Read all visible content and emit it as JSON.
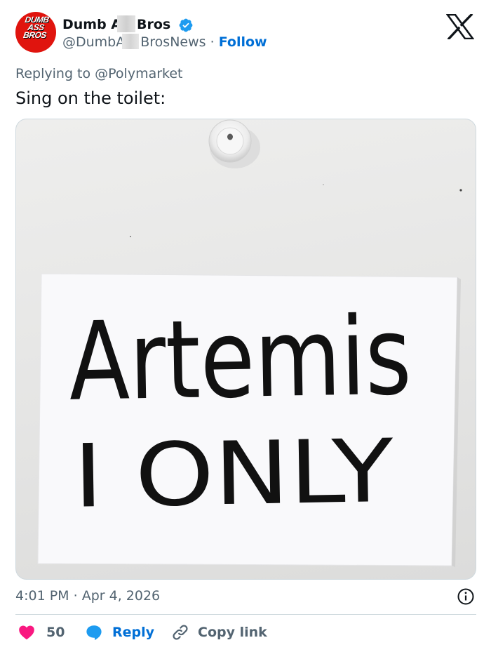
{
  "header": {
    "avatar_text": [
      "DUMB",
      "ASS",
      "BROS"
    ],
    "display_name_start": "Dumb A",
    "display_name_end": "Bros",
    "handle_start": "@DumbA",
    "handle_end": "BrosNews",
    "separator": "·",
    "follow_label": "Follow",
    "verified": true,
    "verified_color": "#1d9bf0"
  },
  "tweet": {
    "replying_prefix": "Replying to ",
    "replying_to": "@Polymarket",
    "text": "Sing on the toilet:",
    "image_text_line1": "Artemis",
    "image_text_line2": "I ONLY"
  },
  "footer": {
    "time": "4:01 PM",
    "separator": "·",
    "date": "Apr 4, 2026",
    "likes": "50",
    "reply_label": "Reply",
    "copy_link_label": "Copy link"
  },
  "colors": {
    "like": "#f91880",
    "reply": "#1d9bf0",
    "link": "#006fd6",
    "avatar_bg": "#e0140e"
  },
  "icons": [
    "verified-badge-icon",
    "x-logo-icon",
    "info-icon",
    "heart-icon",
    "reply-bubble-icon",
    "link-icon"
  ]
}
